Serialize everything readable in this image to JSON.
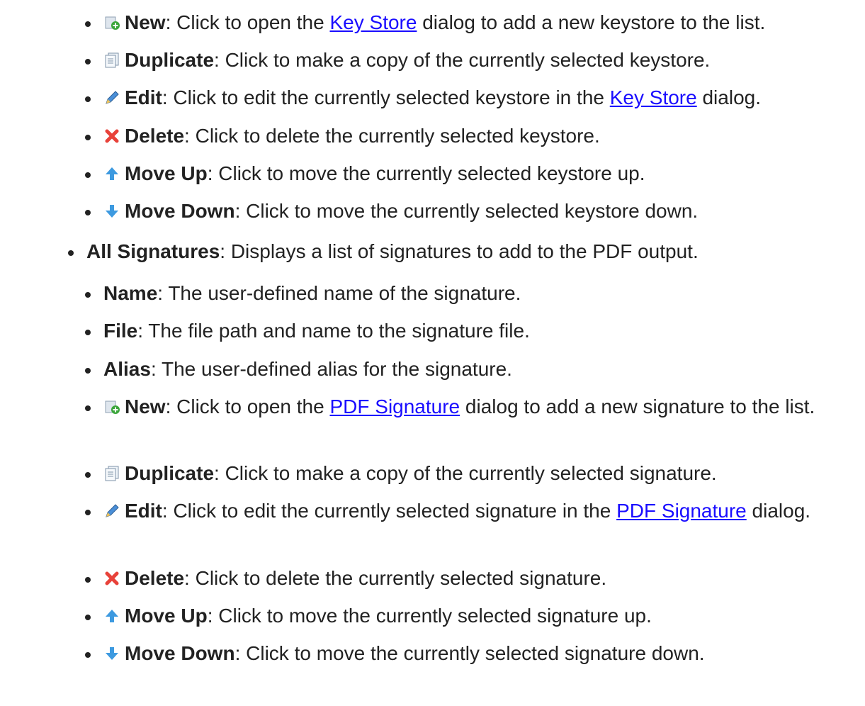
{
  "keystore_section": {
    "items": [
      {
        "icon": "new-document-icon",
        "label": "New",
        "pre": ": Click to open the ",
        "link": "Key Store",
        "post": " dialog to add a new keystore to the list."
      },
      {
        "icon": "duplicate-icon",
        "label": "Duplicate",
        "text": ": Click to make a copy of the currently selected keystore."
      },
      {
        "icon": "pencil-icon",
        "label": "Edit",
        "pre": ": Click to edit the currently selected keystore in the ",
        "link": "Key Store",
        "post": " dialog."
      },
      {
        "icon": "delete-x-icon",
        "label": "Delete",
        "text": ": Click to delete the currently selected keystore."
      },
      {
        "icon": "arrow-up-icon",
        "label": "Move Up",
        "text": ": Click to move the currently selected keystore up."
      },
      {
        "icon": "arrow-down-icon",
        "label": "Move Down",
        "text": ": Click to move the currently selected keystore down."
      }
    ]
  },
  "signatures_section": {
    "label": "All Signatures",
    "text": ": Displays a list of signatures to add to the PDF output.",
    "items": [
      {
        "label": "Name",
        "text": ": The user-defined name of the signature."
      },
      {
        "label": "File",
        "text": ": The file path and name to the signature file."
      },
      {
        "label": "Alias",
        "text": ": The user-defined alias for the signature."
      },
      {
        "icon": "new-document-icon",
        "label": "New",
        "pre": ": Click to open the ",
        "link": "PDF Signature",
        "post": " dialog to add a new signature to the list."
      },
      {
        "icon": "duplicate-icon",
        "label": "Duplicate",
        "text": ": Click to make a copy of the currently selected signature."
      },
      {
        "icon": "pencil-icon",
        "label": "Edit",
        "pre": ": Click to edit the currently selected signature in the ",
        "link": "PDF Signature",
        "post": " dialog."
      },
      {
        "icon": "delete-x-icon",
        "label": "Delete",
        "text": ": Click to delete the currently selected signature."
      },
      {
        "icon": "arrow-up-icon",
        "label": "Move Up",
        "text": ": Click to move the currently selected signature up."
      },
      {
        "icon": "arrow-down-icon",
        "label": "Move Down",
        "text": ": Click to move the currently selected signature down."
      }
    ]
  }
}
